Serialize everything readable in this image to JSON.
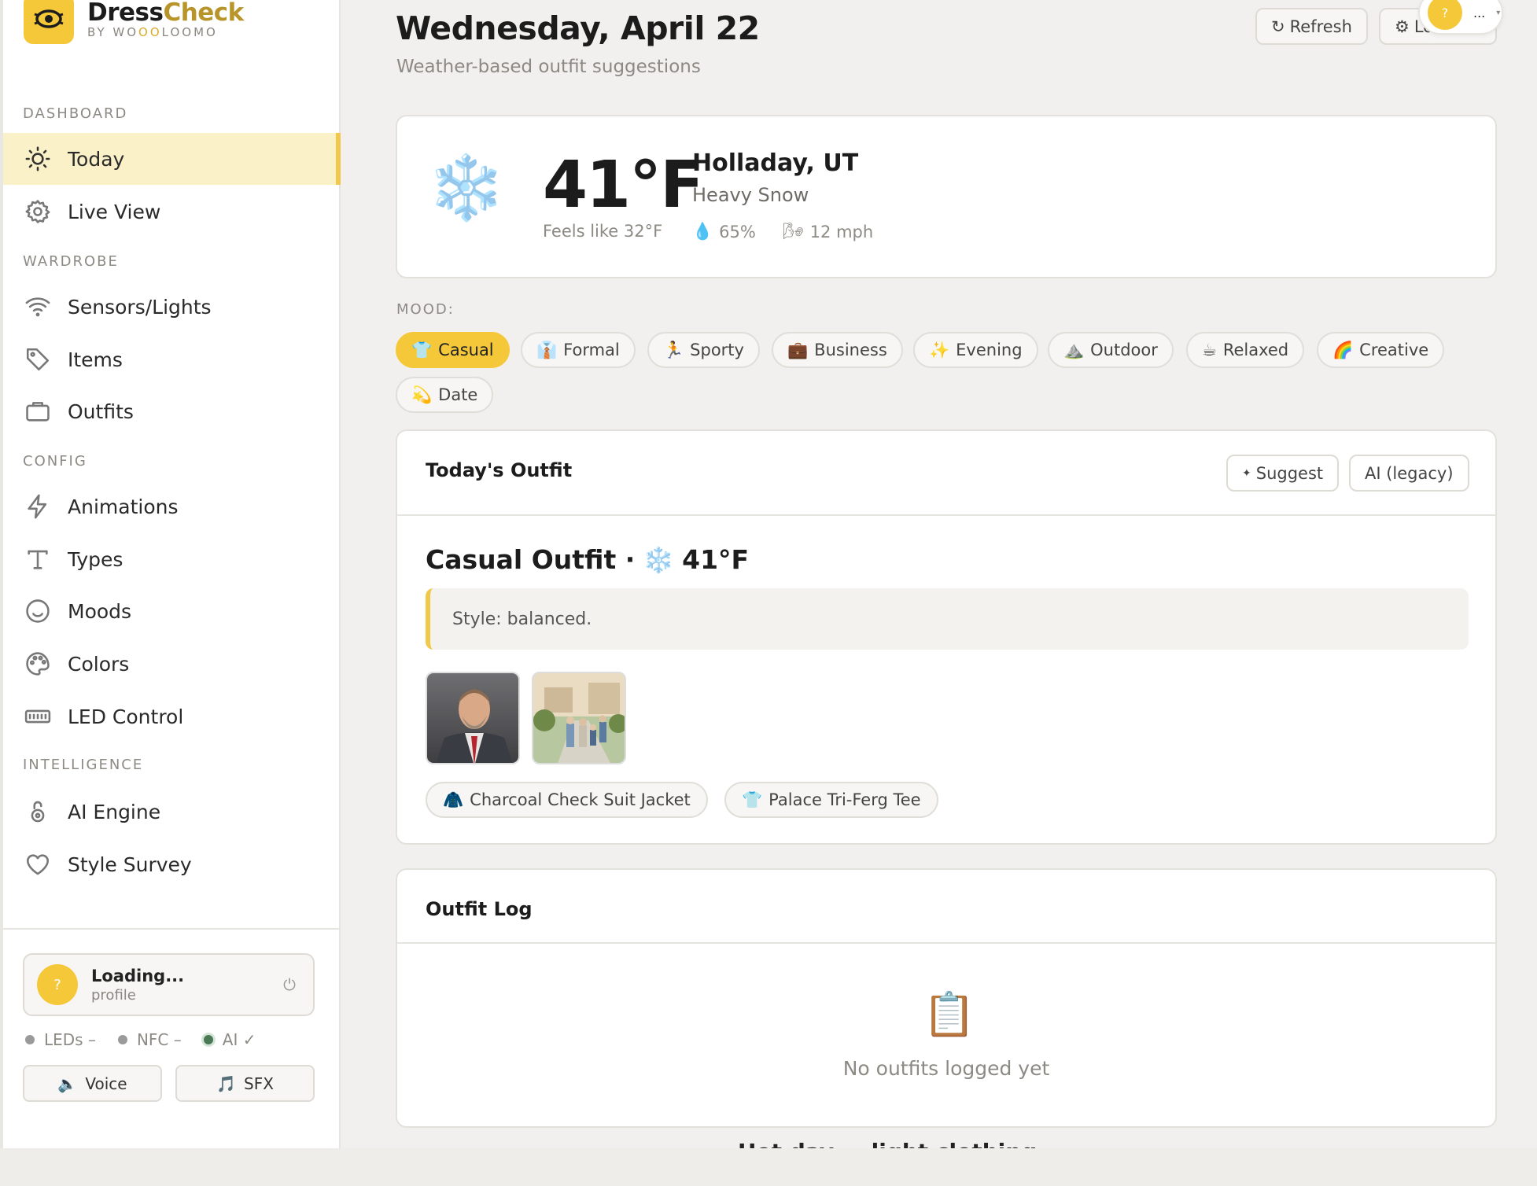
{
  "brand": {
    "name_a": "Dress",
    "name_b": "Check",
    "sub_a": "BY WO",
    "sub_b": "OO",
    "sub_c": "LOOMO"
  },
  "sidebar": {
    "sections": {
      "dashboard": "DASHBOARD",
      "wardrobe": "WARDROBE",
      "config": "CONFIG",
      "intelligence": "INTELLIGENCE"
    },
    "items": [
      {
        "label": "Today",
        "icon": "sun-icon",
        "active": true
      },
      {
        "label": "Live View",
        "icon": "gear-icon"
      },
      {
        "label": "Sensors/Lights",
        "icon": "wifi-icon"
      },
      {
        "label": "Items",
        "icon": "tag-icon"
      },
      {
        "label": "Outfits",
        "icon": "briefcase-icon"
      },
      {
        "label": "Animations",
        "icon": "bolt-icon"
      },
      {
        "label": "Types",
        "icon": "type-icon"
      },
      {
        "label": "Moods",
        "icon": "smile-icon"
      },
      {
        "label": "Colors",
        "icon": "palette-icon"
      },
      {
        "label": "LED Control",
        "icon": "led-strip-icon"
      },
      {
        "label": "AI Engine",
        "icon": "ai-lock-icon"
      },
      {
        "label": "Style Survey",
        "icon": "heart-icon"
      }
    ],
    "profile": {
      "avatar": "?",
      "name": "Loading...",
      "sub": "profile"
    },
    "status": {
      "leds": "LEDs –",
      "nfc": "NFC –",
      "ai": "AI ✓"
    },
    "buttons": {
      "voice": "Voice",
      "sfx": "SFX"
    }
  },
  "header": {
    "title": "Wednesday, April 22",
    "subtitle": "Weather-based outfit suggestions",
    "refresh": "Refresh",
    "second_btn": "Lo",
    "user_avatar": "?",
    "user_menu": "..."
  },
  "weather": {
    "icon": "❄️",
    "temp": "41°F",
    "feels": "Feels like 32°F",
    "location": "Holladay, UT",
    "condition": "Heavy Snow",
    "humidity": "65%",
    "wind": "12 mph"
  },
  "mood": {
    "label": "MOOD:",
    "options": [
      {
        "emoji": "👕",
        "label": "Casual",
        "active": true
      },
      {
        "emoji": "👔",
        "label": "Formal"
      },
      {
        "emoji": "🏃",
        "label": "Sporty"
      },
      {
        "emoji": "💼",
        "label": "Business"
      },
      {
        "emoji": "✨",
        "label": "Evening"
      },
      {
        "emoji": "⛰️",
        "label": "Outdoor"
      },
      {
        "emoji": "☕",
        "label": "Relaxed"
      },
      {
        "emoji": "🌈",
        "label": "Creative"
      },
      {
        "emoji": "💫",
        "label": "Date"
      }
    ]
  },
  "outfit": {
    "heading": "Today's Outfit",
    "suggest": "Suggest",
    "legacy": "AI (legacy)",
    "title": "Casual Outfit ·",
    "title_icon": "❄️",
    "title_temp": "41°F",
    "style": "Style: balanced.",
    "items": [
      {
        "emoji": "🧥",
        "label": "Charcoal Check Suit Jacket"
      },
      {
        "emoji": "👕",
        "label": "Palace Tri-Ferg Tee"
      }
    ]
  },
  "log": {
    "heading": "Outfit Log",
    "empty_icon": "📋",
    "empty": "No outfits logged yet",
    "peek": "Hot day — light clothing"
  },
  "colors": {
    "accent": "#f5c83a",
    "active_bg": "#fbf1c8",
    "ok": "#4a7a55"
  }
}
